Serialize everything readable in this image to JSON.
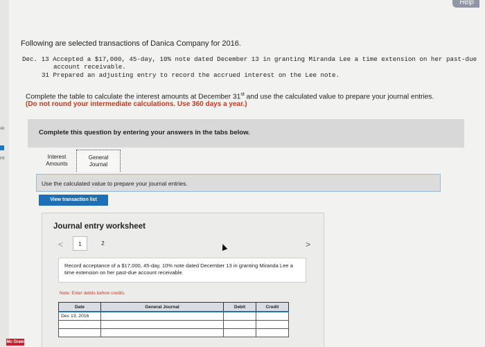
{
  "help": "Help",
  "left_bar": {
    "item1": "ok",
    "item2": "int"
  },
  "logo_text": "Mc Graw",
  "title": "Following are selected transactions of Danica Company for 2016.",
  "transactions": [
    {
      "line1": "Dec. 13 Accepted a $17,000, 45-day, 10% note dated December 13 in granting Miranda Lee a time extension on her past-due",
      "line2": "account receivable."
    },
    {
      "line1": "31 Prepared an adjusting entry to record the accrued interest on the Lee note."
    }
  ],
  "instructions": {
    "pre": "Complete the table to calculate the interest amounts at December 31",
    "sup": "st",
    "post": " and use the calculated value to prepare your journal entries.",
    "bold": "(Do not round your intermediate calculations. Use 360 days a year.)"
  },
  "banner": "Complete this question by entering your answers in the tabs below.",
  "tabs": [
    {
      "label1": "Interest",
      "label2": "Amounts"
    },
    {
      "label1": "General",
      "label2": "Journal"
    }
  ],
  "tab_note": "Use the calculated value to prepare your journal entries.",
  "view_transaction_list": "View transaction list",
  "worksheet": {
    "title": "Journal entry worksheet",
    "prev": "<",
    "next": ">",
    "pages": [
      "1",
      "2"
    ],
    "record_text": "Record acceptance of a $17,000, 45-day, 10% note dated December 13 in granting Miranda Lee a time extension on her past-due account receivable.",
    "note": "Note: Enter debits before credits.",
    "columns": [
      "Date",
      "General Journal",
      "Debit",
      "Credit"
    ],
    "rows": [
      {
        "date": "Dec 13, 2016",
        "account": "",
        "debit": "",
        "credit": ""
      },
      {
        "date": "",
        "account": "",
        "debit": "",
        "credit": ""
      },
      {
        "date": "",
        "account": "",
        "debit": "",
        "credit": ""
      }
    ]
  }
}
